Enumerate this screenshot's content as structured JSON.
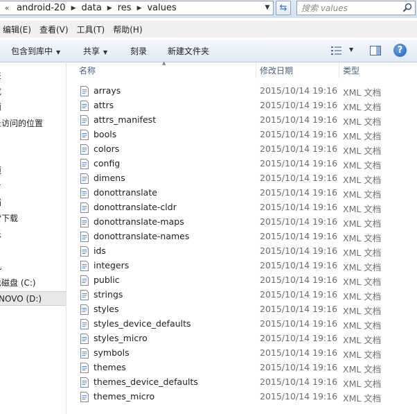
{
  "address": {
    "icon": "folder-icon",
    "overflow": "«",
    "crumbs": [
      "android-20",
      "data",
      "res",
      "values"
    ]
  },
  "search": {
    "placeholder": "搜索 values"
  },
  "menu": [
    "编辑(E)",
    "查看(V)",
    "工具(T)",
    "帮助(H)"
  ],
  "toolbar": {
    "include_library": "包含到库中",
    "share": "共享",
    "burn": "刻录",
    "new_folder": "新建文件夹"
  },
  "nav": [
    "夹",
    "戉",
    "面",
    "丘访问的位置",
    "",
    "须",
    "片",
    "挡",
    "雷下载",
    "乐",
    "",
    "机",
    "也磁盘 (C:)",
    "NOVO (D:)"
  ],
  "columns": {
    "name": "名称",
    "modified": "修改日期",
    "type": "类型"
  },
  "files": [
    {
      "name": "arrays",
      "date": "2015/10/14 19:16",
      "type": "XML 文档"
    },
    {
      "name": "attrs",
      "date": "2015/10/14 19:16",
      "type": "XML 文档"
    },
    {
      "name": "attrs_manifest",
      "date": "2015/10/14 19:16",
      "type": "XML 文档"
    },
    {
      "name": "bools",
      "date": "2015/10/14 19:16",
      "type": "XML 文档"
    },
    {
      "name": "colors",
      "date": "2015/10/14 19:16",
      "type": "XML 文档"
    },
    {
      "name": "config",
      "date": "2015/10/14 19:16",
      "type": "XML 文档"
    },
    {
      "name": "dimens",
      "date": "2015/10/14 19:16",
      "type": "XML 文档"
    },
    {
      "name": "donottranslate",
      "date": "2015/10/14 19:16",
      "type": "XML 文档"
    },
    {
      "name": "donottranslate-cldr",
      "date": "2015/10/14 19:16",
      "type": "XML 文档"
    },
    {
      "name": "donottranslate-maps",
      "date": "2015/10/14 19:16",
      "type": "XML 文档"
    },
    {
      "name": "donottranslate-names",
      "date": "2015/10/14 19:16",
      "type": "XML 文档"
    },
    {
      "name": "ids",
      "date": "2015/10/14 19:16",
      "type": "XML 文档"
    },
    {
      "name": "integers",
      "date": "2015/10/14 19:16",
      "type": "XML 文档"
    },
    {
      "name": "public",
      "date": "2015/10/14 19:16",
      "type": "XML 文档"
    },
    {
      "name": "strings",
      "date": "2015/10/14 19:16",
      "type": "XML 文档"
    },
    {
      "name": "styles",
      "date": "2015/10/14 19:16",
      "type": "XML 文档"
    },
    {
      "name": "styles_device_defaults",
      "date": "2015/10/14 19:16",
      "type": "XML 文档"
    },
    {
      "name": "styles_micro",
      "date": "2015/10/14 19:16",
      "type": "XML 文档"
    },
    {
      "name": "symbols",
      "date": "2015/10/14 19:16",
      "type": "XML 文档"
    },
    {
      "name": "themes",
      "date": "2015/10/14 19:16",
      "type": "XML 文档"
    },
    {
      "name": "themes_device_defaults",
      "date": "2015/10/14 19:16",
      "type": "XML 文档"
    },
    {
      "name": "themes_micro",
      "date": "2015/10/14 19:16",
      "type": "XML 文档"
    }
  ],
  "colors": {
    "header_text": "#4c607a",
    "secondary_text": "#6d6d6d",
    "toolbar_bg": "#dfe9f5"
  }
}
